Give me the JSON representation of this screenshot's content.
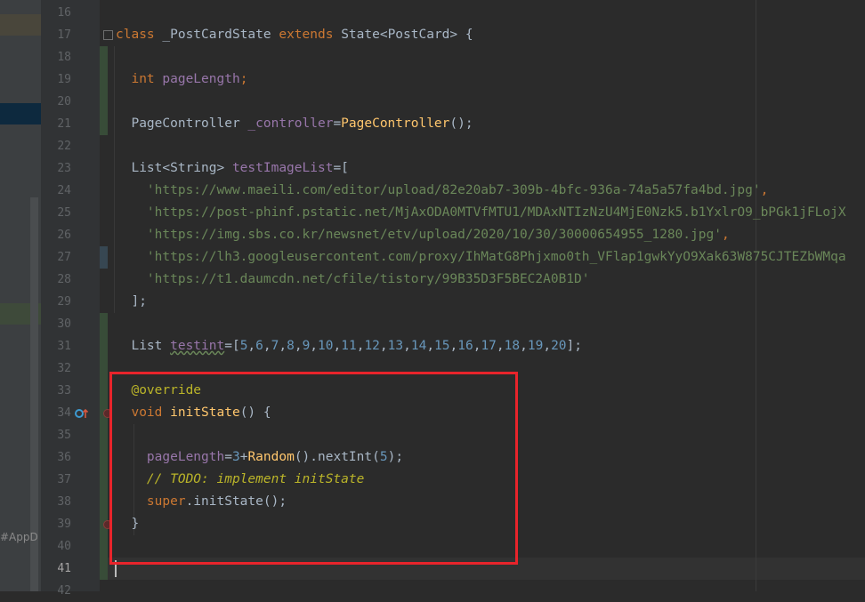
{
  "project_panel": {
    "truncated_label": "#AppD"
  },
  "editor": {
    "current_line": "41",
    "lines": [
      {
        "n": "16"
      },
      {
        "n": "17",
        "tokens": [
          {
            "t": "class ",
            "c": "kw"
          },
          {
            "t": "_PostCardState "
          },
          {
            "t": "extends ",
            "c": "kw"
          },
          {
            "t": "State<PostCard> {"
          }
        ]
      },
      {
        "n": "18"
      },
      {
        "n": "19",
        "tokens": [
          {
            "t": "  "
          },
          {
            "t": "int ",
            "c": "kw"
          },
          {
            "t": "pageLength",
            "c": "fld"
          },
          {
            "t": ";",
            "c": "kw"
          }
        ]
      },
      {
        "n": "20"
      },
      {
        "n": "21",
        "tokens": [
          {
            "t": "  PageController "
          },
          {
            "t": "_controller",
            "c": "fld"
          },
          {
            "t": "="
          },
          {
            "t": "PageController",
            "c": "fn"
          },
          {
            "t": "();"
          }
        ]
      },
      {
        "n": "22"
      },
      {
        "n": "23",
        "tokens": [
          {
            "t": "  List<String> "
          },
          {
            "t": "testImageList",
            "c": "fld"
          },
          {
            "t": "=["
          }
        ]
      },
      {
        "n": "24",
        "tokens": [
          {
            "t": "    "
          },
          {
            "t": "'https://www.maeili.com/editor/upload/82e20ab7-309b-4bfc-936a-74a5a57fa4bd.jpg'",
            "c": "str"
          },
          {
            "t": ",",
            "c": "kw"
          }
        ]
      },
      {
        "n": "25",
        "tokens": [
          {
            "t": "    "
          },
          {
            "t": "'https://post-phinf.pstatic.net/MjAxODA0MTVfMTU1/MDAxNTIzNzU4MjE0Nzk5.b1YxlrO9_bPGk1jFLojX",
            "c": "str"
          }
        ]
      },
      {
        "n": "26",
        "tokens": [
          {
            "t": "    "
          },
          {
            "t": "'https://img.sbs.co.kr/newsnet/etv/upload/2020/10/30/30000654955_1280.jpg'",
            "c": "str"
          },
          {
            "t": ",",
            "c": "kw"
          }
        ]
      },
      {
        "n": "27",
        "tokens": [
          {
            "t": "    "
          },
          {
            "t": "'https://lh3.googleusercontent.com/proxy/IhMatG8Phjxmo0th_VFlap1gwkYyO9Xak63W875CJTEZbWMqa",
            "c": "str"
          }
        ]
      },
      {
        "n": "28",
        "tokens": [
          {
            "t": "    "
          },
          {
            "t": "'https://t1.daumcdn.net/cfile/tistory/99B35D3F5BEC2A0B1D'",
            "c": "str"
          }
        ]
      },
      {
        "n": "29",
        "tokens": [
          {
            "t": "  ];"
          }
        ]
      },
      {
        "n": "30"
      },
      {
        "n": "31",
        "tokens": [
          {
            "t": "  List "
          },
          {
            "t": "testint",
            "c": "fld wavy"
          },
          {
            "t": "=["
          },
          {
            "t": "5",
            "c": "num"
          },
          {
            "t": ","
          },
          {
            "t": "6",
            "c": "num"
          },
          {
            "t": ","
          },
          {
            "t": "7",
            "c": "num"
          },
          {
            "t": ","
          },
          {
            "t": "8",
            "c": "num"
          },
          {
            "t": ","
          },
          {
            "t": "9",
            "c": "num"
          },
          {
            "t": ","
          },
          {
            "t": "10",
            "c": "num"
          },
          {
            "t": ","
          },
          {
            "t": "11",
            "c": "num"
          },
          {
            "t": ","
          },
          {
            "t": "12",
            "c": "num"
          },
          {
            "t": ","
          },
          {
            "t": "13",
            "c": "num"
          },
          {
            "t": ","
          },
          {
            "t": "14",
            "c": "num"
          },
          {
            "t": ","
          },
          {
            "t": "15",
            "c": "num"
          },
          {
            "t": ","
          },
          {
            "t": "16",
            "c": "num"
          },
          {
            "t": ","
          },
          {
            "t": "17",
            "c": "num"
          },
          {
            "t": ","
          },
          {
            "t": "18",
            "c": "num"
          },
          {
            "t": ","
          },
          {
            "t": "19",
            "c": "num"
          },
          {
            "t": ","
          },
          {
            "t": "20",
            "c": "num"
          },
          {
            "t": "];"
          }
        ]
      },
      {
        "n": "32"
      },
      {
        "n": "33",
        "tokens": [
          {
            "t": "  "
          },
          {
            "t": "@override",
            "c": "ann"
          }
        ]
      },
      {
        "n": "34",
        "tokens": [
          {
            "t": "  "
          },
          {
            "t": "void ",
            "c": "kw"
          },
          {
            "t": "initState",
            "c": "fn"
          },
          {
            "t": "() {"
          }
        ]
      },
      {
        "n": "35"
      },
      {
        "n": "36",
        "tokens": [
          {
            "t": "    "
          },
          {
            "t": "pageLength",
            "c": "fld"
          },
          {
            "t": "="
          },
          {
            "t": "3",
            "c": "num"
          },
          {
            "t": "+"
          },
          {
            "t": "Random",
            "c": "fn"
          },
          {
            "t": "().nextInt("
          },
          {
            "t": "5",
            "c": "num"
          },
          {
            "t": ");"
          }
        ]
      },
      {
        "n": "37",
        "tokens": [
          {
            "t": "    "
          },
          {
            "t": "// TODO: implement initState",
            "c": "cmt"
          }
        ]
      },
      {
        "n": "38",
        "tokens": [
          {
            "t": "    "
          },
          {
            "t": "super",
            "c": "kw"
          },
          {
            "t": ".initState();"
          }
        ]
      },
      {
        "n": "39",
        "tokens": [
          {
            "t": "  }"
          }
        ]
      },
      {
        "n": "40"
      },
      {
        "n": "41"
      },
      {
        "n": "42"
      }
    ]
  },
  "colors": {
    "background": "#2b2b2b",
    "gutter": "#313335",
    "keyword": "#cc7832",
    "field": "#9876aa",
    "string": "#6a8759",
    "number": "#6897bb",
    "function": "#ffc66d",
    "annotation": "#bbb529",
    "vcs_added": "#384c38",
    "vcs_modified": "#374752",
    "highlight_box": "#e8242b"
  },
  "icons": [
    "override-method-icon",
    "breakpoint-icon",
    "fold-marker-icon"
  ]
}
